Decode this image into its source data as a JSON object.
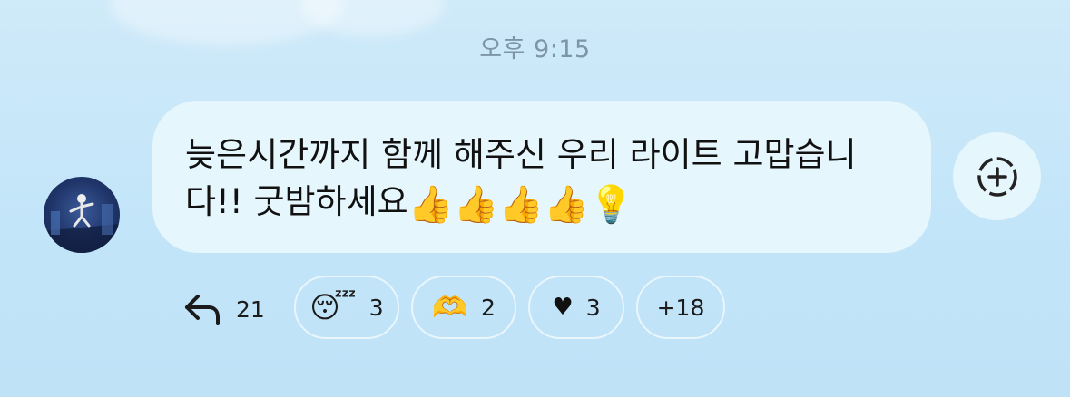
{
  "header": {
    "timestamp": "오후 9:15"
  },
  "message": {
    "text": "늦은시간까지 함께 해주신 우리 라이트 고맙습니다!! 굿밤하세요",
    "emojis": [
      "👍",
      "👍",
      "👍",
      "👍",
      "💡"
    ]
  },
  "actions": {
    "add_reaction_icon": "add-reaction-icon",
    "reply_icon": "reply-arrow-icon",
    "reply_count": "21"
  },
  "reactions": [
    {
      "emoji": "😴",
      "count": "3"
    },
    {
      "emoji": "🫶",
      "count": "2"
    },
    {
      "emoji": "♥",
      "count": "3"
    },
    {
      "emoji": "",
      "count": "+18"
    }
  ],
  "colors": {
    "background": "#c3e5f9",
    "bubble": "#e6f6fd",
    "timestamp": "#7d95a6",
    "text": "#111111"
  }
}
